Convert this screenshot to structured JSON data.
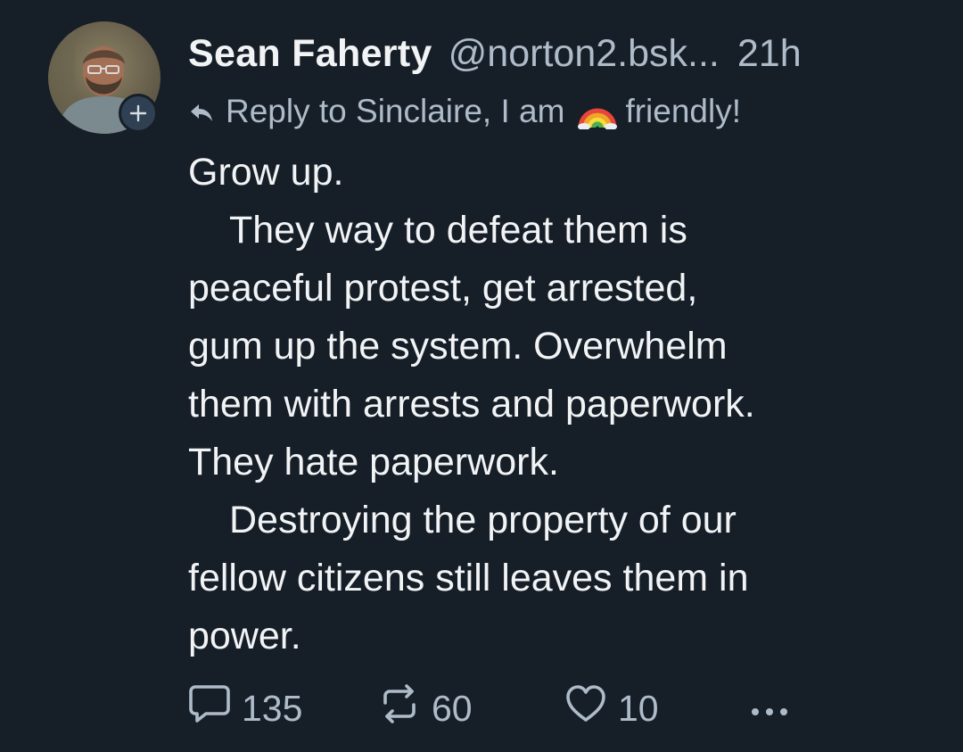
{
  "post": {
    "author": {
      "display_name": "Sean Faherty",
      "handle": "@norton2.bsk...",
      "avatar_icon": "user-avatar-photo",
      "follow_icon": "plus-icon"
    },
    "time": "21h",
    "reply_context": {
      "icon": "reply-arrow-icon",
      "prefix": "Reply to Sinclaire, I am",
      "emoji": "rainbow-icon",
      "suffix": "friendly!"
    },
    "body": {
      "line1": "Grow up.",
      "paragraph2": [
        "They way to defeat them is",
        "peaceful protest, get arrested,",
        "gum up the system. Overwhelm",
        "them with arrests and paperwork.",
        "They hate paperwork."
      ],
      "paragraph3": [
        "Destroying the property of our",
        "fellow citizens still leaves them in",
        "power."
      ]
    },
    "actions": {
      "reply": {
        "icon": "comment-icon",
        "count": "135"
      },
      "repost": {
        "icon": "repost-icon",
        "count": "60"
      },
      "like": {
        "icon": "heart-icon",
        "count": "10"
      },
      "more": {
        "icon": "more-dots-icon"
      }
    },
    "colors": {
      "background": "#161e27",
      "text_primary": "#f1f3f5",
      "text_secondary": "#aebbc9"
    }
  }
}
